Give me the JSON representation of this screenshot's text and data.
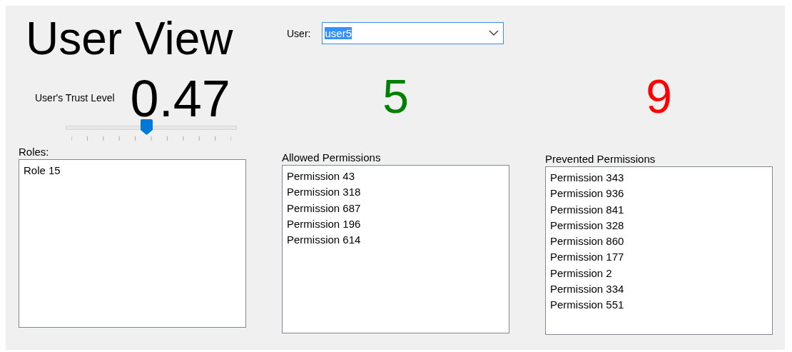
{
  "title": "User View",
  "user_field": {
    "label": "User:",
    "value": "user5",
    "text_selected": true
  },
  "trust": {
    "label": "User's Trust Level",
    "value": "0.47",
    "level": 0.47
  },
  "panels": [
    {
      "label": "Roles:",
      "items": [
        "Role 15"
      ]
    },
    {
      "label": "Allowed Permissions",
      "count": "5",
      "color": "#008000",
      "items": [
        "Permission 43",
        "Permission 318",
        "Permission 687",
        "Permission 196",
        "Permission 614"
      ]
    },
    {
      "label": "Prevented Permissions",
      "count": "9",
      "color": "#ff0000",
      "items": [
        "Permission 343",
        "Permission 936",
        "Permission 841",
        "Permission 328",
        "Permission 860",
        "Permission 177",
        "Permission 2",
        "Permission 334",
        "Permission 551"
      ]
    }
  ]
}
